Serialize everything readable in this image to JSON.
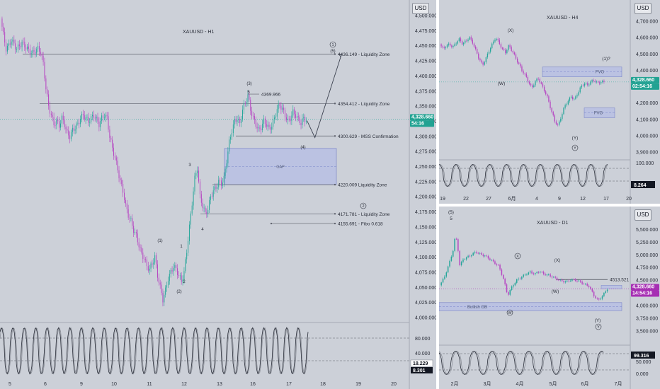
{
  "colors": {
    "bg": "#ccd0d8",
    "up": "#26a69a",
    "down": "#b645c2",
    "level": "#5d606b",
    "dotted": "#7e8596",
    "zone": "#b6bee5",
    "zone_edge": "#7b86c9",
    "price_tag": "#21a292",
    "price_tag_d1": "#a62fb3",
    "osc_a": "#2a2e39",
    "osc_b": "#8b8f98"
  },
  "h1": {
    "title": "XAUUSD - H1",
    "currency": "USD",
    "price_label": "4,328.660",
    "countdown": "54:16",
    "osc_values": [
      "18.229",
      "8.301"
    ],
    "x_labels": [
      "5",
      "6",
      "9",
      "10",
      "11",
      "12",
      "13",
      "16",
      "17",
      "18",
      "19",
      "20"
    ],
    "y_ticks": [
      "4,500.000",
      "4,475.000",
      "4,450.000",
      "4,425.000",
      "4,400.000",
      "4,375.000",
      "4,350.000",
      "4,325.000",
      "4,300.000",
      "4,275.000",
      "4,250.000",
      "4,225.000",
      "4,200.000",
      "4,175.000",
      "4,150.000",
      "4,125.000",
      "4,100.000",
      "4,075.000",
      "4,050.000",
      "4,025.000",
      "4,000.000"
    ],
    "osc_ticks": [
      "80.000",
      "40.000"
    ],
    "levels": [
      {
        "value": 4436.149,
        "label": "4436.149 - Liquidity Zone"
      },
      {
        "value": 4354.412,
        "label": "4354.412 - Liquidity Zone"
      },
      {
        "value": 4300.629,
        "label": "4300.629 - MSS Confirmation"
      },
      {
        "value": 4220.009,
        "label": "4220.009 Liquidity Zone"
      },
      {
        "value": 4171.781,
        "label": "4171.781 - Liquidity Zone"
      },
      {
        "value": 4155.691,
        "label": "4155.691 - Fibo 0.618"
      }
    ],
    "high_label": "4369.966",
    "gap_label": "GAP",
    "wave_labels": [
      "(1)",
      "(2)",
      "1",
      "2",
      "3",
      "4",
      "(3)",
      "5",
      "(4)",
      "(5)"
    ],
    "circled": [
      "1",
      "2"
    ]
  },
  "h4": {
    "title": "XAUUSD - H4",
    "currency": "USD",
    "price_label": "4,328.660",
    "countdown": "02:54:16",
    "osc_value": "8.264",
    "osc_ticks": [
      "100.000"
    ],
    "x_labels": [
      "19",
      "22",
      "27",
      "6月",
      "4",
      "9",
      "12",
      "17",
      "20"
    ],
    "y_ticks": [
      "4,700.000",
      "4,600.000",
      "4,500.000",
      "4,400.000",
      "4,300.000",
      "4,200.000",
      "4,100.000",
      "4,000.000",
      "3,900.000"
    ],
    "zones": [
      "FVG",
      "FVG"
    ],
    "wave_labels": [
      "(X)",
      "(W)",
      "(Y)",
      "(1)?"
    ],
    "circled": [
      "Y"
    ]
  },
  "d1": {
    "title": "XAUUSD - D1",
    "currency": "USD",
    "price_label": "4,328.660",
    "countdown": "14:54:16",
    "osc_value": "99.316",
    "osc_ticks": [
      "50.000",
      "0.000"
    ],
    "x_labels": [
      "2月",
      "3月",
      "4月",
      "5月",
      "6月",
      "7月"
    ],
    "y_ticks": [
      "5,500.000",
      "5,250.000",
      "5,000.000",
      "4,750.000",
      "4,500.000",
      "4,250.000",
      "4,000.000",
      "3,750.000",
      "3,500.000"
    ],
    "level_label": "4513.521",
    "zone_label": "Bullish OB",
    "wave_labels": [
      "(5)",
      "5",
      "(X)",
      "(W)",
      "(Y)"
    ],
    "circled": [
      "X",
      "W",
      "Y"
    ]
  },
  "chart_data": [
    {
      "type": "candlestick",
      "title": "XAUUSD - H1",
      "ylim": [
        4000,
        4500
      ],
      "x_ticks": [
        "5",
        "6",
        "9",
        "10",
        "11",
        "12",
        "13",
        "16",
        "17",
        "18",
        "19",
        "20"
      ],
      "close_path": [
        [
          0,
          4495
        ],
        [
          2,
          4468
        ],
        [
          4,
          4445
        ],
        [
          6,
          4450
        ],
        [
          8,
          4460
        ],
        [
          10,
          4452
        ],
        [
          12,
          4445
        ],
        [
          14,
          4450
        ],
        [
          16,
          4455
        ],
        [
          18,
          4450
        ],
        [
          20,
          4445
        ],
        [
          22,
          4440
        ],
        [
          24,
          4438
        ],
        [
          26,
          4442
        ],
        [
          28,
          4445
        ],
        [
          30,
          4440
        ],
        [
          32,
          4420
        ],
        [
          34,
          4380
        ],
        [
          36,
          4350
        ],
        [
          38,
          4335
        ],
        [
          40,
          4320
        ],
        [
          42,
          4325
        ],
        [
          44,
          4318
        ],
        [
          46,
          4330
        ],
        [
          48,
          4320
        ],
        [
          50,
          4305
        ],
        [
          52,
          4300
        ],
        [
          54,
          4310
        ],
        [
          56,
          4315
        ],
        [
          58,
          4320
        ],
        [
          60,
          4330
        ],
        [
          62,
          4335
        ],
        [
          64,
          4330
        ],
        [
          66,
          4325
        ],
        [
          68,
          4330
        ],
        [
          70,
          4335
        ],
        [
          72,
          4328
        ],
        [
          74,
          4320
        ],
        [
          76,
          4330
        ],
        [
          78,
          4335
        ],
        [
          80,
          4330
        ],
        [
          82,
          4300
        ],
        [
          84,
          4280
        ],
        [
          86,
          4265
        ],
        [
          88,
          4245
        ],
        [
          90,
          4225
        ],
        [
          92,
          4210
        ],
        [
          94,
          4185
        ],
        [
          96,
          4170
        ],
        [
          98,
          4160
        ],
        [
          100,
          4145
        ],
        [
          102,
          4135
        ],
        [
          104,
          4120
        ],
        [
          106,
          4105
        ],
        [
          108,
          4098
        ],
        [
          110,
          4085
        ],
        [
          112,
          4080
        ],
        [
          114,
          4090
        ],
        [
          116,
          4100
        ],
        [
          118,
          4070
        ],
        [
          120,
          4050
        ],
        [
          122,
          4030
        ],
        [
          124,
          4045
        ],
        [
          126,
          4065
        ],
        [
          128,
          4075
        ],
        [
          130,
          4085
        ],
        [
          132,
          4080
        ],
        [
          134,
          4070
        ],
        [
          136,
          4060
        ],
        [
          138,
          4075
        ],
        [
          140,
          4110
        ],
        [
          142,
          4150
        ],
        [
          144,
          4190
        ],
        [
          146,
          4230
        ],
        [
          148,
          4248
        ],
        [
          150,
          4200
        ],
        [
          152,
          4185
        ],
        [
          154,
          4172
        ],
        [
          156,
          4180
        ],
        [
          158,
          4200
        ],
        [
          160,
          4210
        ],
        [
          162,
          4215
        ],
        [
          164,
          4225
        ],
        [
          166,
          4222
        ],
        [
          168,
          4230
        ],
        [
          170,
          4260
        ],
        [
          172,
          4290
        ],
        [
          174,
          4310
        ],
        [
          176,
          4325
        ],
        [
          178,
          4330
        ],
        [
          180,
          4320
        ],
        [
          182,
          4345
        ],
        [
          184,
          4355
        ],
        [
          186,
          4368
        ],
        [
          188,
          4345
        ],
        [
          190,
          4330
        ],
        [
          192,
          4320
        ],
        [
          194,
          4310
        ],
        [
          196,
          4315
        ],
        [
          198,
          4325
        ],
        [
          200,
          4320
        ],
        [
          202,
          4312
        ],
        [
          204,
          4318
        ],
        [
          206,
          4330
        ],
        [
          208,
          4345
        ],
        [
          210,
          4352
        ],
        [
          212,
          4345
        ],
        [
          214,
          4335
        ],
        [
          216,
          4325
        ],
        [
          218,
          4330
        ],
        [
          220,
          4340
        ],
        [
          222,
          4335
        ],
        [
          224,
          4328
        ],
        [
          226,
          4322
        ],
        [
          228,
          4330
        ],
        [
          230,
          4326
        ]
      ],
      "projection": [
        [
          230,
          4326
        ],
        [
          236,
          4298
        ],
        [
          256,
          4436
        ]
      ]
    },
    {
      "type": "candlestick",
      "title": "XAUUSD - H4",
      "ylim": [
        3900,
        4700
      ],
      "x_ticks": [
        "19",
        "22",
        "27",
        "6月",
        "4",
        "9",
        "12",
        "17",
        "20"
      ],
      "close_path": [
        [
          0,
          4560
        ],
        [
          4,
          4530
        ],
        [
          8,
          4550
        ],
        [
          12,
          4560
        ],
        [
          16,
          4540
        ],
        [
          20,
          4570
        ],
        [
          24,
          4590
        ],
        [
          28,
          4560
        ],
        [
          32,
          4580
        ],
        [
          36,
          4600
        ],
        [
          40,
          4570
        ],
        [
          44,
          4520
        ],
        [
          48,
          4470
        ],
        [
          52,
          4430
        ],
        [
          56,
          4470
        ],
        [
          60,
          4520
        ],
        [
          64,
          4560
        ],
        [
          68,
          4600
        ],
        [
          72,
          4570
        ],
        [
          76,
          4530
        ],
        [
          80,
          4510
        ],
        [
          84,
          4550
        ],
        [
          88,
          4520
        ],
        [
          92,
          4480
        ],
        [
          96,
          4440
        ],
        [
          100,
          4400
        ],
        [
          104,
          4370
        ],
        [
          108,
          4330
        ],
        [
          112,
          4290
        ],
        [
          116,
          4330
        ],
        [
          120,
          4350
        ],
        [
          124,
          4310
        ],
        [
          128,
          4270
        ],
        [
          132,
          4220
        ],
        [
          136,
          4150
        ],
        [
          140,
          4090
        ],
        [
          144,
          4060
        ],
        [
          148,
          4120
        ],
        [
          152,
          4180
        ],
        [
          156,
          4210
        ],
        [
          160,
          4240
        ],
        [
          164,
          4220
        ],
        [
          168,
          4260
        ],
        [
          172,
          4300
        ],
        [
          176,
          4320
        ],
        [
          180,
          4310
        ],
        [
          184,
          4330
        ],
        [
          188,
          4340
        ],
        [
          192,
          4320
        ],
        [
          196,
          4330
        ],
        [
          200,
          4328
        ]
      ]
    },
    {
      "type": "candlestick",
      "title": "XAUUSD - D1",
      "ylim": [
        3500,
        5700
      ],
      "x_ticks": [
        "2月",
        "3月",
        "4月",
        "5月",
        "6月",
        "7月"
      ],
      "close_path": [
        [
          0,
          4400
        ],
        [
          4,
          4550
        ],
        [
          8,
          4800
        ],
        [
          12,
          5100
        ],
        [
          14,
          5400
        ],
        [
          16,
          5150
        ],
        [
          18,
          4750
        ],
        [
          20,
          4900
        ],
        [
          24,
          4950
        ],
        [
          28,
          5000
        ],
        [
          32,
          5060
        ],
        [
          36,
          5010
        ],
        [
          40,
          4980
        ],
        [
          44,
          4920
        ],
        [
          48,
          4850
        ],
        [
          52,
          4780
        ],
        [
          56,
          4550
        ],
        [
          60,
          4200
        ],
        [
          64,
          4380
        ],
        [
          68,
          4500
        ],
        [
          72,
          4560
        ],
        [
          76,
          4620
        ],
        [
          80,
          4660
        ],
        [
          84,
          4620
        ],
        [
          88,
          4680
        ],
        [
          92,
          4620
        ],
        [
          96,
          4600
        ],
        [
          100,
          4560
        ],
        [
          104,
          4520
        ],
        [
          108,
          4480
        ],
        [
          112,
          4470
        ],
        [
          116,
          4510
        ],
        [
          120,
          4500
        ],
        [
          124,
          4470
        ],
        [
          128,
          4420
        ],
        [
          132,
          4380
        ],
        [
          136,
          4200
        ],
        [
          140,
          4100
        ],
        [
          144,
          4200
        ],
        [
          148,
          4330
        ]
      ]
    }
  ]
}
